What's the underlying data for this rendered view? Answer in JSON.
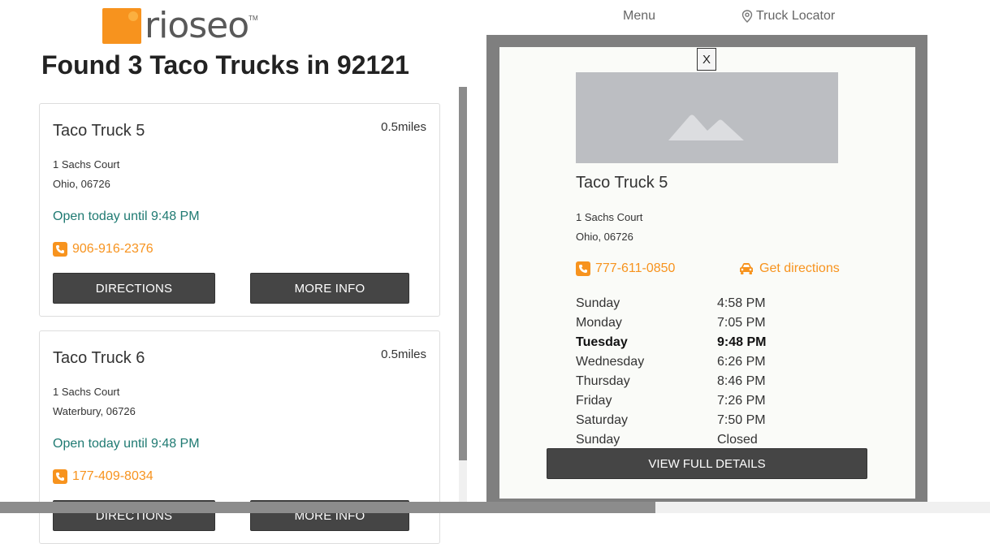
{
  "brand": {
    "logo_text": "rioseo",
    "trademark": "TM",
    "logo_color": "#f7931e"
  },
  "nav": {
    "menu_label": "Menu",
    "locator_label": "Truck Locator",
    "locator_icon": "map-pin-icon"
  },
  "page": {
    "title": "Found 3 Taco Trucks in 92121"
  },
  "results": [
    {
      "name": "Taco Truck 5",
      "distance": "0.5miles",
      "address_line1": "1 Sachs Court",
      "address_line2": "Ohio, 06726",
      "open_status": "Open today until 9:48 PM",
      "phone": "906-916-2376",
      "directions_label": "DIRECTIONS",
      "more_info_label": "MORE INFO"
    },
    {
      "name": "Taco Truck 6",
      "distance": "0.5miles",
      "address_line1": "1 Sachs Court",
      "address_line2": "Waterbury, 06726",
      "open_status": "Open today until 9:48 PM",
      "phone": "177-409-8034",
      "directions_label": "DIRECTIONS",
      "more_info_label": "MORE INFO"
    }
  ],
  "modal": {
    "close_label": "X",
    "image_icon": "image-placeholder-icon",
    "name": "Taco Truck 5",
    "address_line1": "1 Sachs Court",
    "address_line2": "Ohio, 06726",
    "phone": "777-611-0850",
    "directions_label": "Get directions",
    "hours": [
      {
        "day": "Sunday",
        "time": "4:58 PM"
      },
      {
        "day": "Monday",
        "time": "7:05 PM"
      },
      {
        "day": "Tuesday",
        "time": "9:48 PM",
        "today": true
      },
      {
        "day": "Wednesday",
        "time": "6:26 PM"
      },
      {
        "day": "Thursday",
        "time": "8:46 PM"
      },
      {
        "day": "Friday",
        "time": "7:26 PM"
      },
      {
        "day": "Saturday",
        "time": "7:50 PM"
      },
      {
        "day": "Sunday",
        "time": "Closed"
      }
    ],
    "view_full_label": "VIEW FULL DETAILS"
  },
  "colors": {
    "accent": "#f7931e",
    "open_text": "#1f7a72",
    "button_dark": "#454545"
  }
}
